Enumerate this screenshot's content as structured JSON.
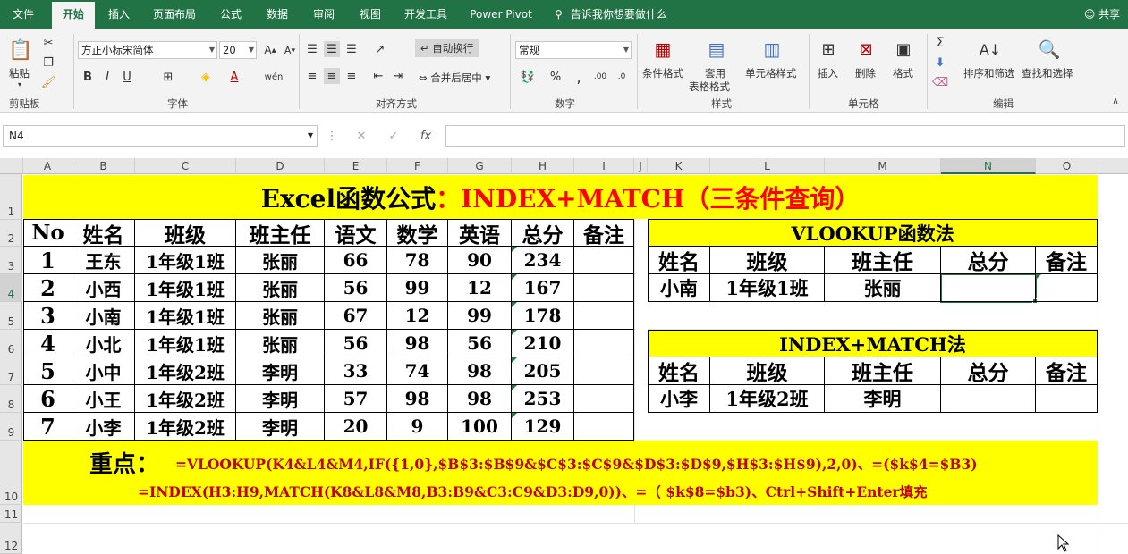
{
  "ribbon_tabs": [
    "文件",
    "开始",
    "插入",
    "页面布局",
    "公式",
    "数据",
    "审阅",
    "视图",
    "开发工具",
    "Power Pivot"
  ],
  "tell_me": "告诉我你想要做什么",
  "share": "共享",
  "clipboard": {
    "paste": "粘贴",
    "group": "剪贴板"
  },
  "font": {
    "name": "方正小标宋简体",
    "size": "20",
    "group": "字体"
  },
  "alignment": {
    "wrap": "自动换行",
    "merge": "合并后居中",
    "group": "对齐方式"
  },
  "number": {
    "format": "常规",
    "group": "数字"
  },
  "styles": {
    "cond": "条件格式",
    "table": "套用",
    "table2": "表格格式",
    "cell": "单元格样式",
    "group": "样式"
  },
  "cells": {
    "insert": "插入",
    "delete": "删除",
    "format": "格式",
    "group": "单元格"
  },
  "editing": {
    "sort": "排序和筛选",
    "find": "查找和选择",
    "group": "编辑"
  },
  "name_box": "N4",
  "columns": [
    "A",
    "B",
    "C",
    "D",
    "E",
    "F",
    "G",
    "H",
    "I",
    "J",
    "K",
    "L",
    "M",
    "N",
    "O"
  ],
  "rows": [
    "1",
    "2",
    "3",
    "4",
    "5",
    "6",
    "7",
    "8",
    "9",
    "10",
    "11",
    "12"
  ],
  "title": {
    "part1": "Excel函数公式",
    "part2": "：INDEX+MATCH（三条件查询）",
    "color_black": "#000000",
    "color_red": "#ff0000"
  },
  "main_table": {
    "headers": [
      "No",
      "姓名",
      "班级",
      "班主任",
      "语文",
      "数学",
      "英语",
      "总分",
      "备注"
    ],
    "rows": [
      [
        "1",
        "王东",
        "1年级1班",
        "张丽",
        "66",
        "78",
        "90",
        "234",
        ""
      ],
      [
        "2",
        "小西",
        "1年级1班",
        "张丽",
        "56",
        "99",
        "12",
        "167",
        ""
      ],
      [
        "3",
        "小南",
        "1年级1班",
        "张丽",
        "67",
        "12",
        "99",
        "178",
        ""
      ],
      [
        "4",
        "小北",
        "1年级1班",
        "张丽",
        "56",
        "98",
        "56",
        "210",
        ""
      ],
      [
        "5",
        "小中",
        "1年级2班",
        "李明",
        "33",
        "74",
        "98",
        "205",
        ""
      ],
      [
        "6",
        "小王",
        "1年级2班",
        "李明",
        "57",
        "98",
        "98",
        "253",
        ""
      ],
      [
        "7",
        "小李",
        "1年级2班",
        "李明",
        "20",
        "9",
        "100",
        "129",
        ""
      ]
    ]
  },
  "vlookup": {
    "title": "VLOOKUP函数法",
    "headers": [
      "姓名",
      "班级",
      "班主任",
      "总分",
      "备注"
    ],
    "row": [
      "小南",
      "1年级1班",
      "张丽",
      "",
      ""
    ]
  },
  "indexmatch": {
    "title": "INDEX+MATCH法",
    "headers": [
      "姓名",
      "班级",
      "班主任",
      "总分",
      "备注"
    ],
    "row": [
      "小李",
      "1年级2班",
      "李明",
      "",
      ""
    ]
  },
  "notes": {
    "label": "重点：",
    "line1": "=VLOOKUP(K4&L4&M4,IF({1,0},$B$3:$B$9&$C$3:$C$9&$D$3:$D$9,$H$3:$H$9),2,0)、=($k$4=$B3)",
    "line2": "=INDEX(H3:H9,MATCH(K8&L8&M8,B3:B9&C3:C9&D3:D9,0))、=（ $k$8=$b3)、Ctrl+Shift+Enter填充"
  },
  "colors": {
    "excel_green": "#217346",
    "highlight": "#ffff00",
    "note_red": "#c00000"
  }
}
